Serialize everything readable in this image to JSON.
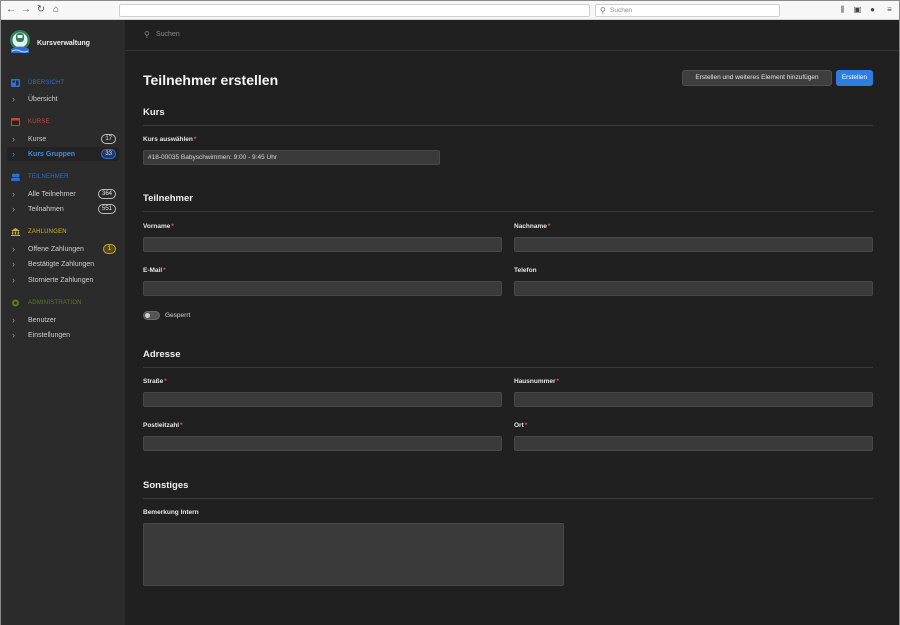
{
  "browser": {
    "search_placeholder": "Suchen",
    "nav_icons": [
      "back-icon",
      "forward-icon",
      "reload-icon",
      "home-icon"
    ],
    "toolbar_icons": [
      "library-icon",
      "sidebar-icon",
      "account-icon",
      "menu-icon"
    ]
  },
  "sidebar": {
    "brand": "Kursverwaltung",
    "groups": [
      {
        "label": "ÜBERSICHT",
        "color": "#2f6fd0",
        "icon": "dashboard-icon"
      },
      {
        "label": "KURSE",
        "color": "#d0453a",
        "icon": "calendar-icon"
      },
      {
        "label": "TEILNEHMER",
        "color": "#2f6fd0",
        "icon": "users-icon"
      },
      {
        "label": "ZAHLUNGEN",
        "color": "#d6b42a",
        "icon": "bank-icon"
      },
      {
        "label": "ADMINISTRATION",
        "color": "#5a7a1e",
        "icon": "gear-icon"
      }
    ],
    "items": [
      {
        "label": "Übersicht"
      },
      {
        "label": "Kurse",
        "badge": "17"
      },
      {
        "label": "Kurs Gruppen",
        "badge": "33",
        "active": true
      },
      {
        "label": "Alle Teilnehmer",
        "badge": "364"
      },
      {
        "label": "Teilnahmen",
        "badge": "551"
      },
      {
        "label": "Offene Zahlungen",
        "badge": "1"
      },
      {
        "label": "Bestätigte Zahlungen"
      },
      {
        "label": "Stornierte Zahlungen"
      },
      {
        "label": "Benutzer"
      },
      {
        "label": "Einstellungen"
      }
    ]
  },
  "topbar": {
    "search_placeholder": "Suchen"
  },
  "main": {
    "title": "Teilnehmer erstellen",
    "create_another_label": "Erstellen und weiteres Element hinzufügen",
    "create_label": "Erstellen",
    "sections": {
      "kurs": "Kurs",
      "teilnehmer": "Teilnehmer",
      "adresse": "Adresse",
      "sonstiges": "Sonstiges"
    },
    "fields": {
      "kurs_auswaehlen": {
        "label": "Kurs auswählen",
        "value": "#18-00035 Babyschwimmen: 9:00 - 9:45 Uhr"
      },
      "vorname": {
        "label": "Vorname"
      },
      "nachname": {
        "label": "Nachname"
      },
      "email": {
        "label": "E-Mail"
      },
      "telefon": {
        "label": "Telefon"
      },
      "gesperrt": {
        "label": "Gesperrt",
        "checked": false
      },
      "strasse": {
        "label": "Straße"
      },
      "hausnummer": {
        "label": "Hausnummer"
      },
      "postleitzahl": {
        "label": "Postleitzahl"
      },
      "ort": {
        "label": "Ort"
      },
      "bemerkung": {
        "label": "Bemerkung Intern"
      }
    }
  },
  "colors": {
    "accent": "#2f7de0",
    "required": "#e05a5a",
    "sidebar_bg": "#2b2b2b",
    "content_bg": "#202020"
  }
}
